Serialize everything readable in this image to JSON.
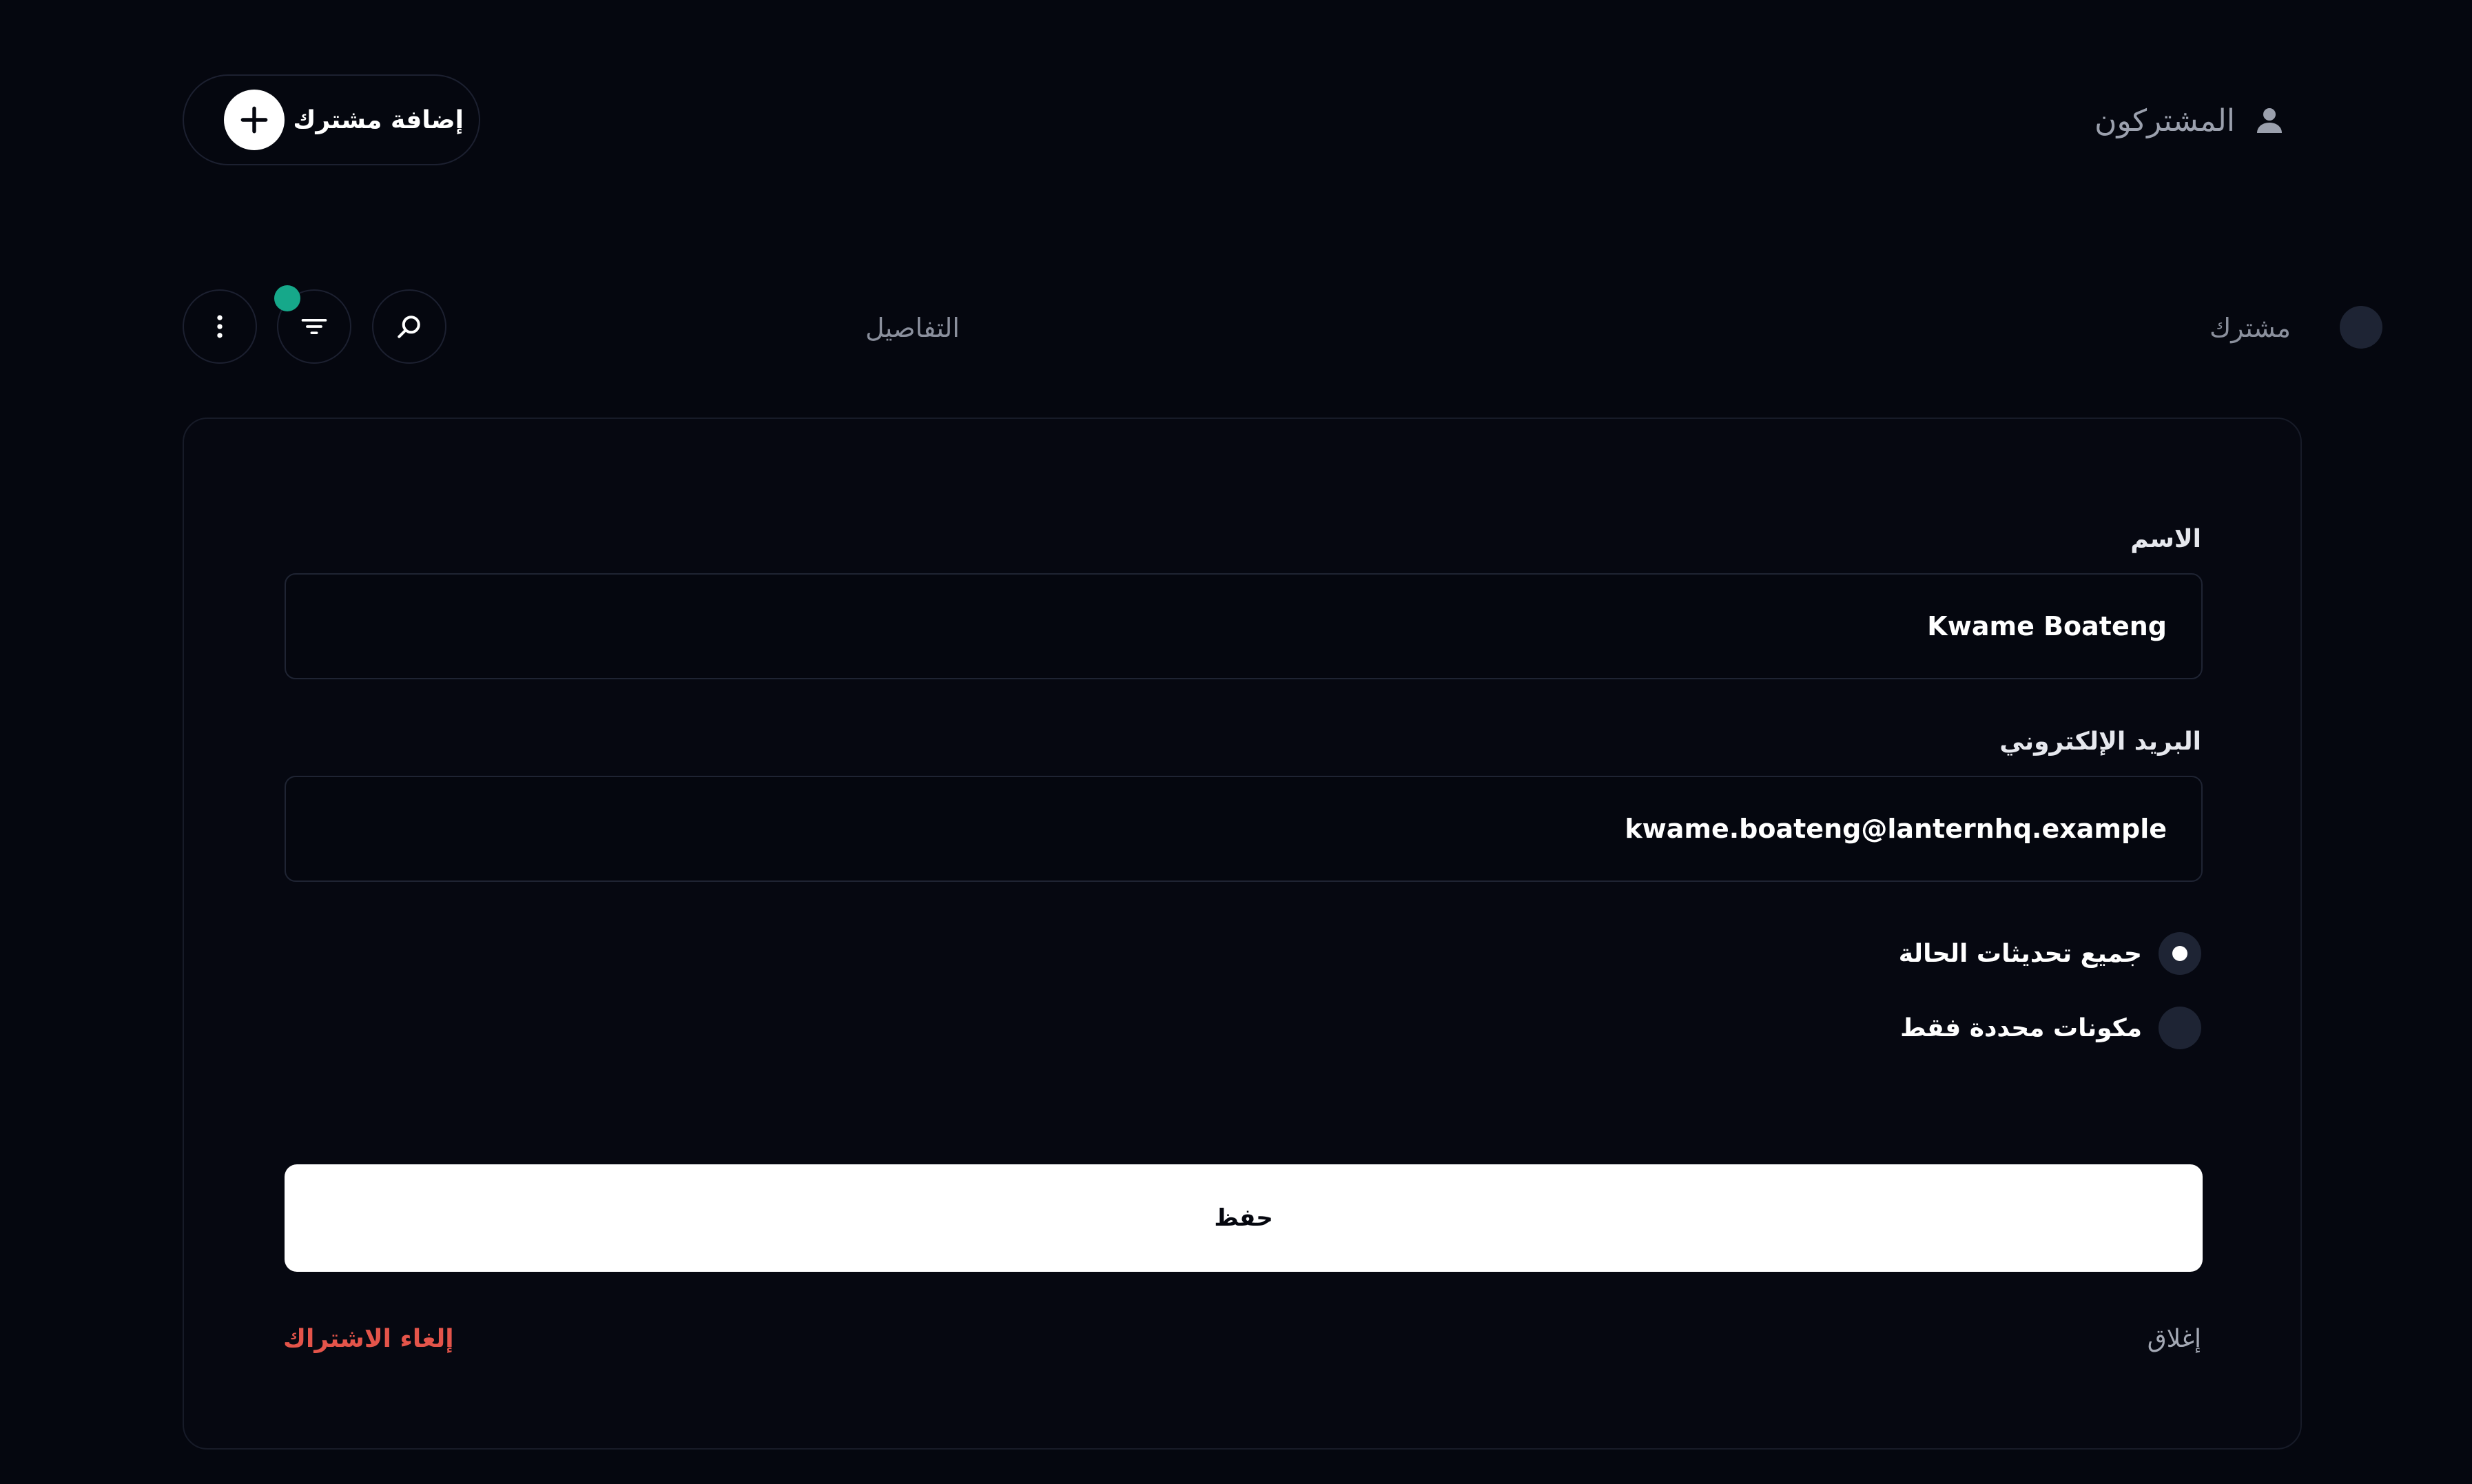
{
  "header": {
    "title": "المشتركون",
    "title_icon": "user-icon",
    "add_button_label": "إضافة مشترك",
    "add_button_icon": "plus-icon"
  },
  "tabs": {
    "subscriber": "مشترك",
    "details": "التفاصيل"
  },
  "toolbar": {
    "search_icon": "search-icon",
    "filter_icon": "filter-icon",
    "more_icon": "more-vertical-icon",
    "filter_badge_color": "#16a88a"
  },
  "form": {
    "name_label": "الاسم",
    "name_value": "Kwame Boateng",
    "email_label": "البريد الإلكتروني",
    "email_value": "kwame.boateng@lanternhq.example",
    "options": [
      {
        "label": "جميع تحديثات الحالة",
        "selected": true
      },
      {
        "label": "مكونات محددة فقط",
        "selected": false
      }
    ],
    "save_label": "حفظ",
    "close_label": "إغلاق",
    "unsubscribe_label": "إلغاء الاشتراك"
  },
  "colors": {
    "background": "#05070f",
    "danger": "#e4544a",
    "accent": "#16a88a"
  }
}
